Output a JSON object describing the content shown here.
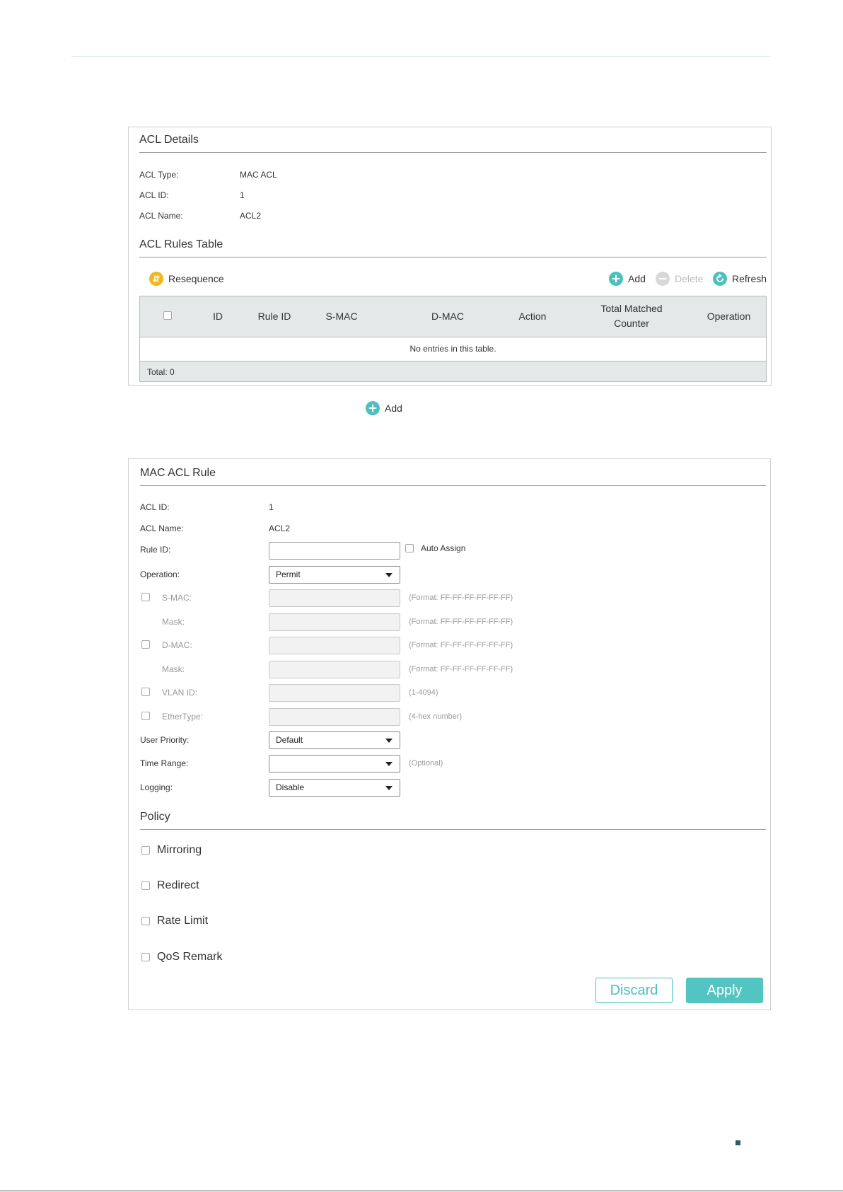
{
  "acl_details": {
    "title": "ACL Details",
    "fields": [
      {
        "label": "ACL Type:",
        "value": "MAC ACL"
      },
      {
        "label": "ACL ID:",
        "value": "1"
      },
      {
        "label": "ACL Name:",
        "value": "ACL2"
      }
    ]
  },
  "rules_table": {
    "title": "ACL Rules Table",
    "toolbar": {
      "resequence": "Resequence",
      "add": "Add",
      "delete": "Delete",
      "refresh": "Refresh"
    },
    "columns": [
      "ID",
      "Rule ID",
      "S-MAC",
      "D-MAC",
      "Action",
      "Total Matched Counter",
      "Operation"
    ],
    "empty_text": "No entries in this table.",
    "total": "Total: 0"
  },
  "between_add": "Add",
  "mac_rule": {
    "title": "MAC ACL Rule",
    "acl_id_label": "ACL ID:",
    "acl_id_value": "1",
    "acl_name_label": "ACL Name:",
    "acl_name_value": "ACL2",
    "rule_id_label": "Rule ID:",
    "rule_id_value": "",
    "auto_assign_label": "Auto Assign",
    "operation_label": "Operation:",
    "operation_value": "Permit",
    "smac_label": "S-MAC:",
    "smac_hint": "(Format: FF-FF-FF-FF-FF-FF)",
    "smac_mask_label": "Mask:",
    "smac_mask_hint": "(Format: FF-FF-FF-FF-FF-FF)",
    "dmac_label": "D-MAC:",
    "dmac_hint": "(Format: FF-FF-FF-FF-FF-FF)",
    "dmac_mask_label": "Mask:",
    "dmac_mask_hint": "(Format: FF-FF-FF-FF-FF-FF)",
    "vlan_label": "VLAN ID:",
    "vlan_hint": "(1-4094)",
    "ethertype_label": "EtherType:",
    "ethertype_hint": "(4-hex number)",
    "user_priority_label": "User Priority:",
    "user_priority_value": "Default",
    "time_range_label": "Time Range:",
    "time_range_value": "",
    "time_range_hint": "(Optional)",
    "logging_label": "Logging:",
    "logging_value": "Disable"
  },
  "policy": {
    "title": "Policy",
    "items": [
      "Mirroring",
      "Redirect",
      "Rate Limit",
      "QoS Remark"
    ]
  },
  "buttons": {
    "discard": "Discard",
    "apply": "Apply"
  },
  "colors": {
    "accent": "#4cc0bd",
    "resequence": "#f1b71c"
  }
}
